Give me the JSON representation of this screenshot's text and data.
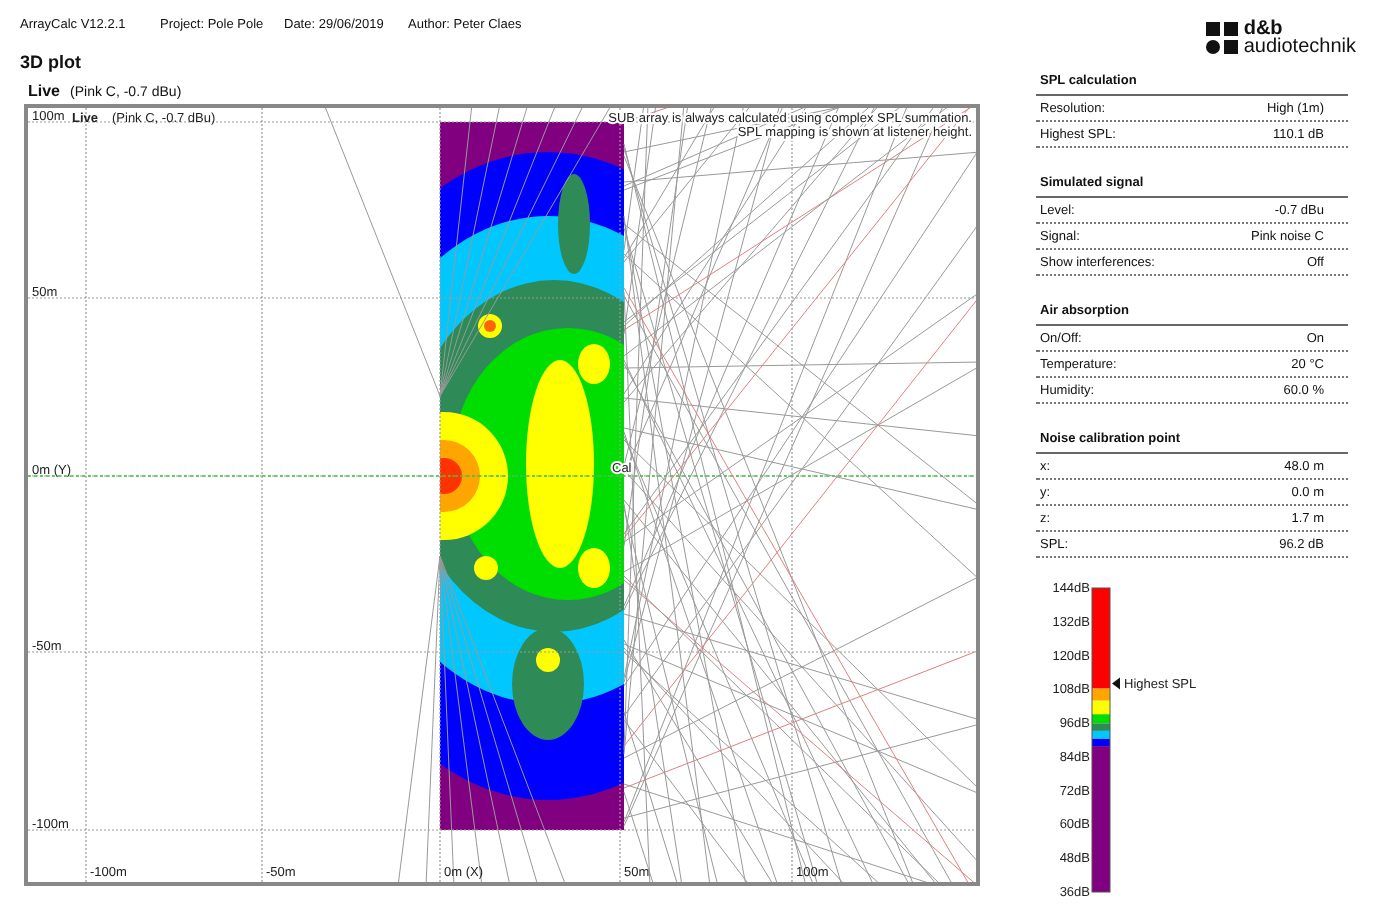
{
  "header": {
    "app": "ArrayCalc V12.2.1",
    "project": "Project: Pole Pole",
    "date": "Date: 29/06/2019",
    "author": "Author: Peter Claes"
  },
  "logo": {
    "brand": "d&b",
    "name": "audiotechnik"
  },
  "page_title": "3D plot",
  "plot": {
    "title": "Live",
    "subtitle": "(Pink C, -0.7 dBu)",
    "inset_title": "Live",
    "inset_subtitle": "(Pink C, -0.7 dBu)",
    "notes": [
      "SUB array is always calculated using complex SPL summation.",
      "SPL mapping is shown at listener height."
    ],
    "x_ticks": [
      "-100m",
      "-50m",
      "0m (X)",
      "50m",
      "100m"
    ],
    "y_ticks": [
      "100m",
      "50m",
      "0m (Y)",
      "-50m",
      "-100m"
    ],
    "source_label": "Cal"
  },
  "sections": [
    {
      "title": "SPL calculation",
      "rows": [
        {
          "label": "Resolution:",
          "value": "High (1m)"
        },
        {
          "label": "Highest SPL:",
          "value": "110.1 dB"
        }
      ]
    },
    {
      "title": "Simulated signal",
      "rows": [
        {
          "label": "Level:",
          "value": "-0.7 dBu"
        },
        {
          "label": "Signal:",
          "value": "Pink noise C"
        },
        {
          "label": "Show interferences:",
          "value": "Off"
        }
      ]
    },
    {
      "title": "Air absorption",
      "rows": [
        {
          "label": "On/Off:",
          "value": "On"
        },
        {
          "label": "Temperature:",
          "value": "20 °C"
        },
        {
          "label": "Humidity:",
          "value": "60.0 %"
        }
      ]
    },
    {
      "title": "Noise calibration point",
      "rows": [
        {
          "label": "x:",
          "value": "48.0 m"
        },
        {
          "label": "y:",
          "value": "0.0 m"
        },
        {
          "label": "z:",
          "value": "1.7 m"
        },
        {
          "label": "SPL:",
          "value": "96.2 dB"
        }
      ]
    }
  ],
  "scale": {
    "ticks": [
      "144dB",
      "132dB",
      "120dB",
      "108dB",
      "96dB",
      "84dB",
      "72dB",
      "60dB",
      "48dB",
      "36dB"
    ],
    "marker": {
      "label": "Highest SPL",
      "level": 0.686
    }
  }
}
